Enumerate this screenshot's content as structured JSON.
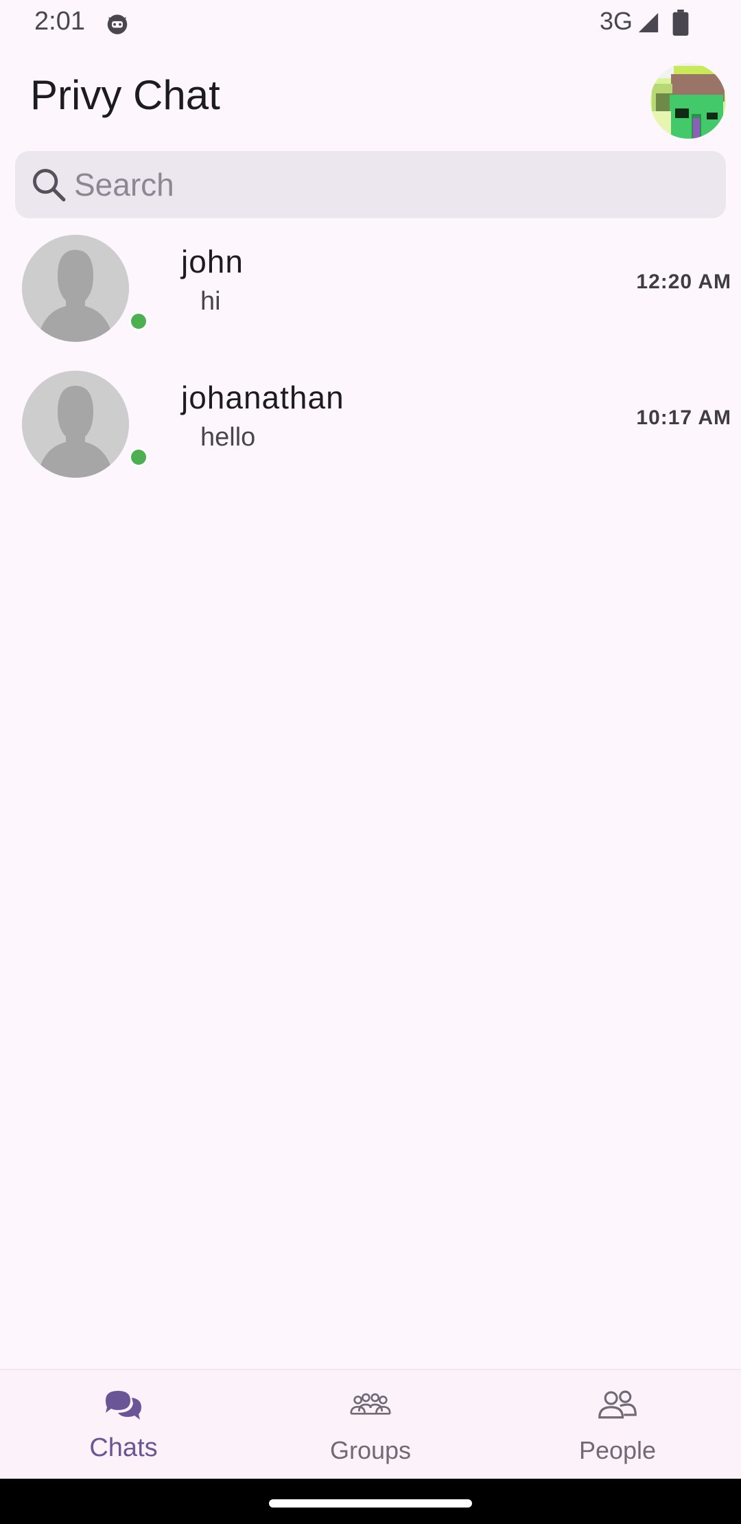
{
  "status_bar": {
    "time": "2:01",
    "network": "3G",
    "app_icon": "cat-face-icon",
    "signal_icon": "cellular-signal-icon",
    "battery_icon": "battery-icon"
  },
  "header": {
    "title": "Privy Chat",
    "avatar_icon": "pixel-art-profile-avatar"
  },
  "search": {
    "placeholder": "Search",
    "value": "",
    "icon": "search-icon"
  },
  "chats": [
    {
      "name": "john",
      "last_message": "hi",
      "time": "12:20 AM",
      "online": true,
      "avatar_icon": "default-person-avatar"
    },
    {
      "name": "johanathan",
      "last_message": "hello",
      "time": "10:17 AM",
      "online": true,
      "avatar_icon": "default-person-avatar"
    }
  ],
  "bottom_nav": {
    "items": [
      {
        "label": "Chats",
        "icon": "chat-bubbles-icon",
        "active": true
      },
      {
        "label": "Groups",
        "icon": "groups-icon",
        "active": false
      },
      {
        "label": "People",
        "icon": "people-icon",
        "active": false
      }
    ]
  },
  "colors": {
    "background": "#fdf7fd",
    "accent": "#6a5597",
    "online": "#4caf50",
    "search_bg": "#ece7ee"
  }
}
